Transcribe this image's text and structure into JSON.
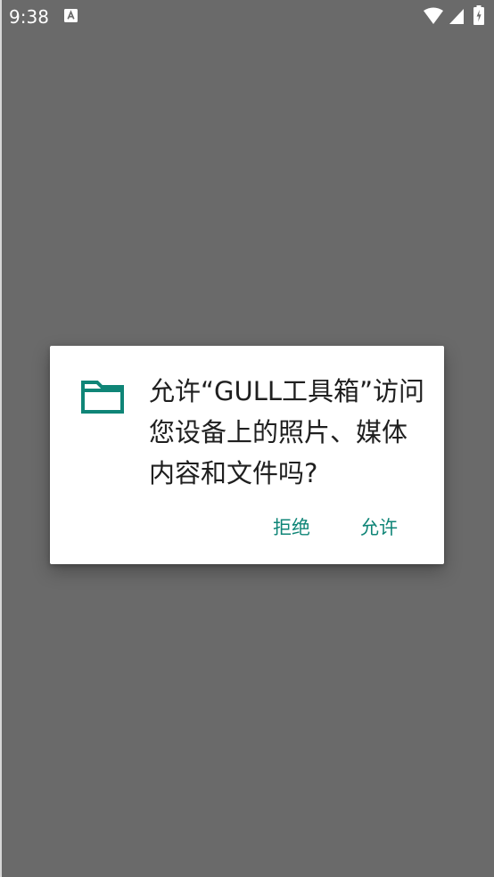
{
  "status_bar": {
    "time": "9:38",
    "notification_icon": "text-a-icon",
    "wifi_icon": "wifi-icon",
    "signal_icon": "cellular-signal-icon",
    "battery_icon": "battery-charging-icon"
  },
  "permission_dialog": {
    "icon": "folder-icon",
    "message": "允许“GULL工具箱”访问您设备上的照片、媒体内容和文件吗?",
    "deny_label": "拒绝",
    "allow_label": "允许"
  },
  "colors": {
    "scrim": "#6a6a6a",
    "accent": "#0f8577",
    "dialog_background": "#ffffff",
    "text": "#1f1f1f"
  }
}
